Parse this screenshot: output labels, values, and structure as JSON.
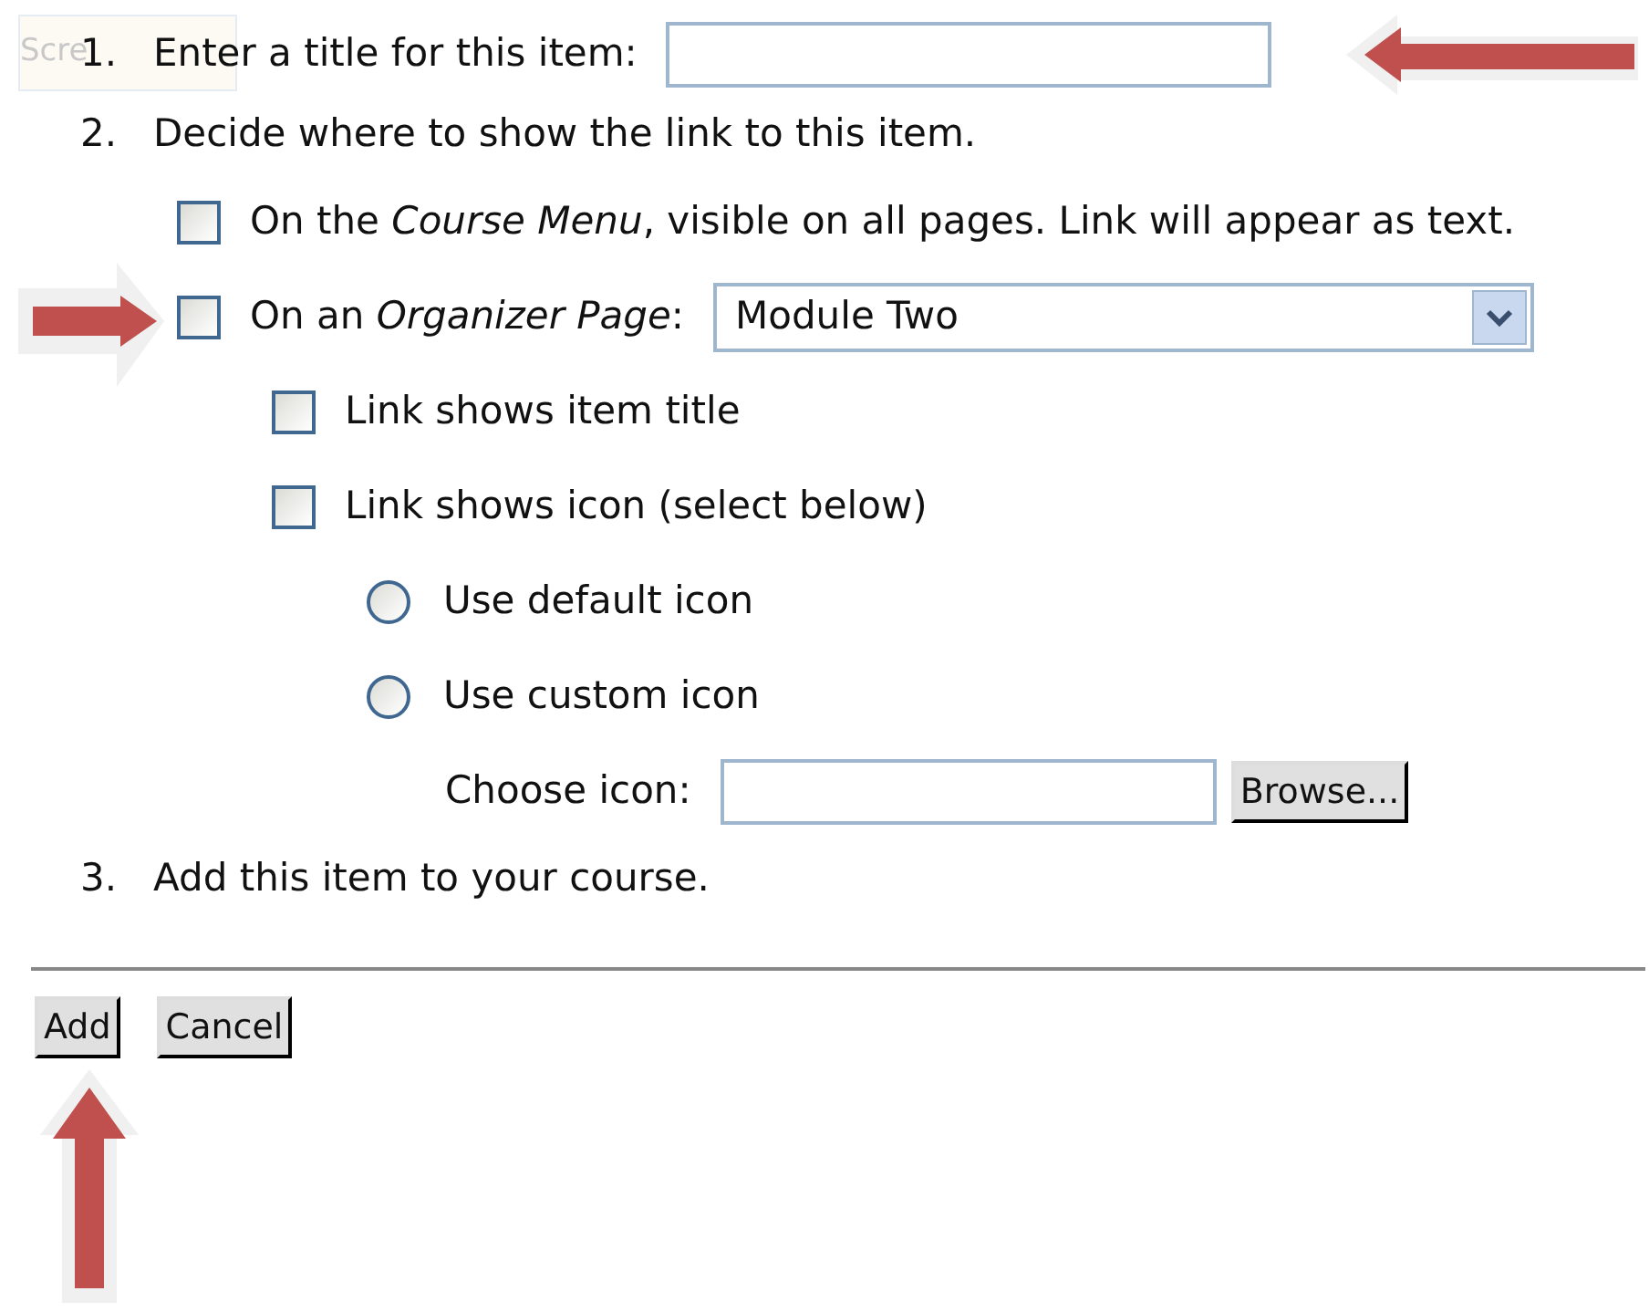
{
  "tag": {
    "text": "Scre"
  },
  "steps": [
    {
      "number": "1.",
      "label": "Enter a title for this item:",
      "field": {
        "kind": "text"
      }
    },
    {
      "number": "2.",
      "label": "Decide where to show the link to this item.",
      "options": [
        {
          "kind": "checkbox",
          "label": "On the *Course Menu*, visible on all pages. Link will appear as text.",
          "checked": false
        },
        {
          "kind": "checkbox",
          "label": "On an *Organizer Page*:",
          "checked": false,
          "select": {
            "value": "Module Two"
          },
          "children": [
            {
              "kind": "checkbox",
              "label": "Link shows item title",
              "checked": false
            },
            {
              "kind": "checkbox",
              "label": "Link shows icon (select below)",
              "checked": false,
              "children": [
                {
                  "kind": "radio",
                  "label": "Use default icon",
                  "selected": false
                },
                {
                  "kind": "radio",
                  "label": "Use custom icon",
                  "selected": false
                },
                {
                  "kind": "file",
                  "label": "Choose icon:",
                  "button": "Browse..."
                }
              ]
            }
          ]
        }
      ]
    },
    {
      "number": "3.",
      "label": "Add this item to your course."
    }
  ],
  "buttons": [
    {
      "label": "Add"
    },
    {
      "label": "Cancel"
    }
  ]
}
